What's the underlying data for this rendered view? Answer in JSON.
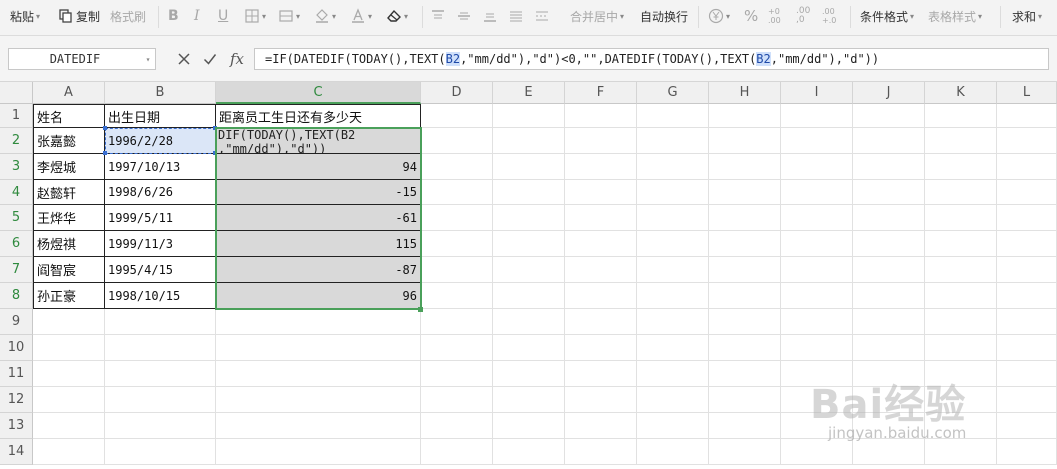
{
  "toolbar": {
    "paste": "粘贴",
    "copy": "复制",
    "format_painter": "格式刷",
    "merge_center": "合并居中",
    "wrap_text": "自动换行",
    "percent": "%",
    "conditional_format": "条件格式",
    "table_style": "表格样式",
    "sum": "求和"
  },
  "formula_bar": {
    "name_box": "DATEDIF",
    "fx": "fx",
    "formula_parts": [
      "=IF(DATEDIF(TODAY(),TEXT(",
      "B2",
      ",\"mm/dd\"),\"d\")<0,\"\",DATEDIF(TODAY(),TEXT(",
      "B2",
      ",\"mm/dd\"),\"d\"))"
    ]
  },
  "columns": [
    "A",
    "B",
    "C",
    "D",
    "E",
    "F",
    "G",
    "H",
    "I",
    "J",
    "K",
    "L"
  ],
  "rows": [
    "1",
    "2",
    "3",
    "4",
    "5",
    "6",
    "7",
    "8",
    "9",
    "10",
    "11",
    "12",
    "13",
    "14"
  ],
  "table": {
    "headers": [
      "姓名",
      "出生日期",
      "距离员工生日还有多少天"
    ],
    "editing_cell_text": "DIF(TODAY(),TEXT(B2\n,\"mm/dd\"),\"d\"))",
    "rows": [
      {
        "name": "张嘉懿",
        "birth": "1996/2/28",
        "days": ""
      },
      {
        "name": "李煜城",
        "birth": "1997/10/13",
        "days": "94"
      },
      {
        "name": "赵懿轩",
        "birth": "1998/6/26",
        "days": "-15"
      },
      {
        "name": "王烨华",
        "birth": "1999/5/11",
        "days": "-61"
      },
      {
        "name": "杨煜祺",
        "birth": "1999/11/3",
        "days": "115"
      },
      {
        "name": "阎智宸",
        "birth": "1995/4/15",
        "days": "-87"
      },
      {
        "name": "孙正豪",
        "birth": "1998/10/15",
        "days": "96"
      }
    ]
  },
  "watermark": {
    "brand": "Bai经验",
    "url": "jingyan.baidu.com"
  }
}
